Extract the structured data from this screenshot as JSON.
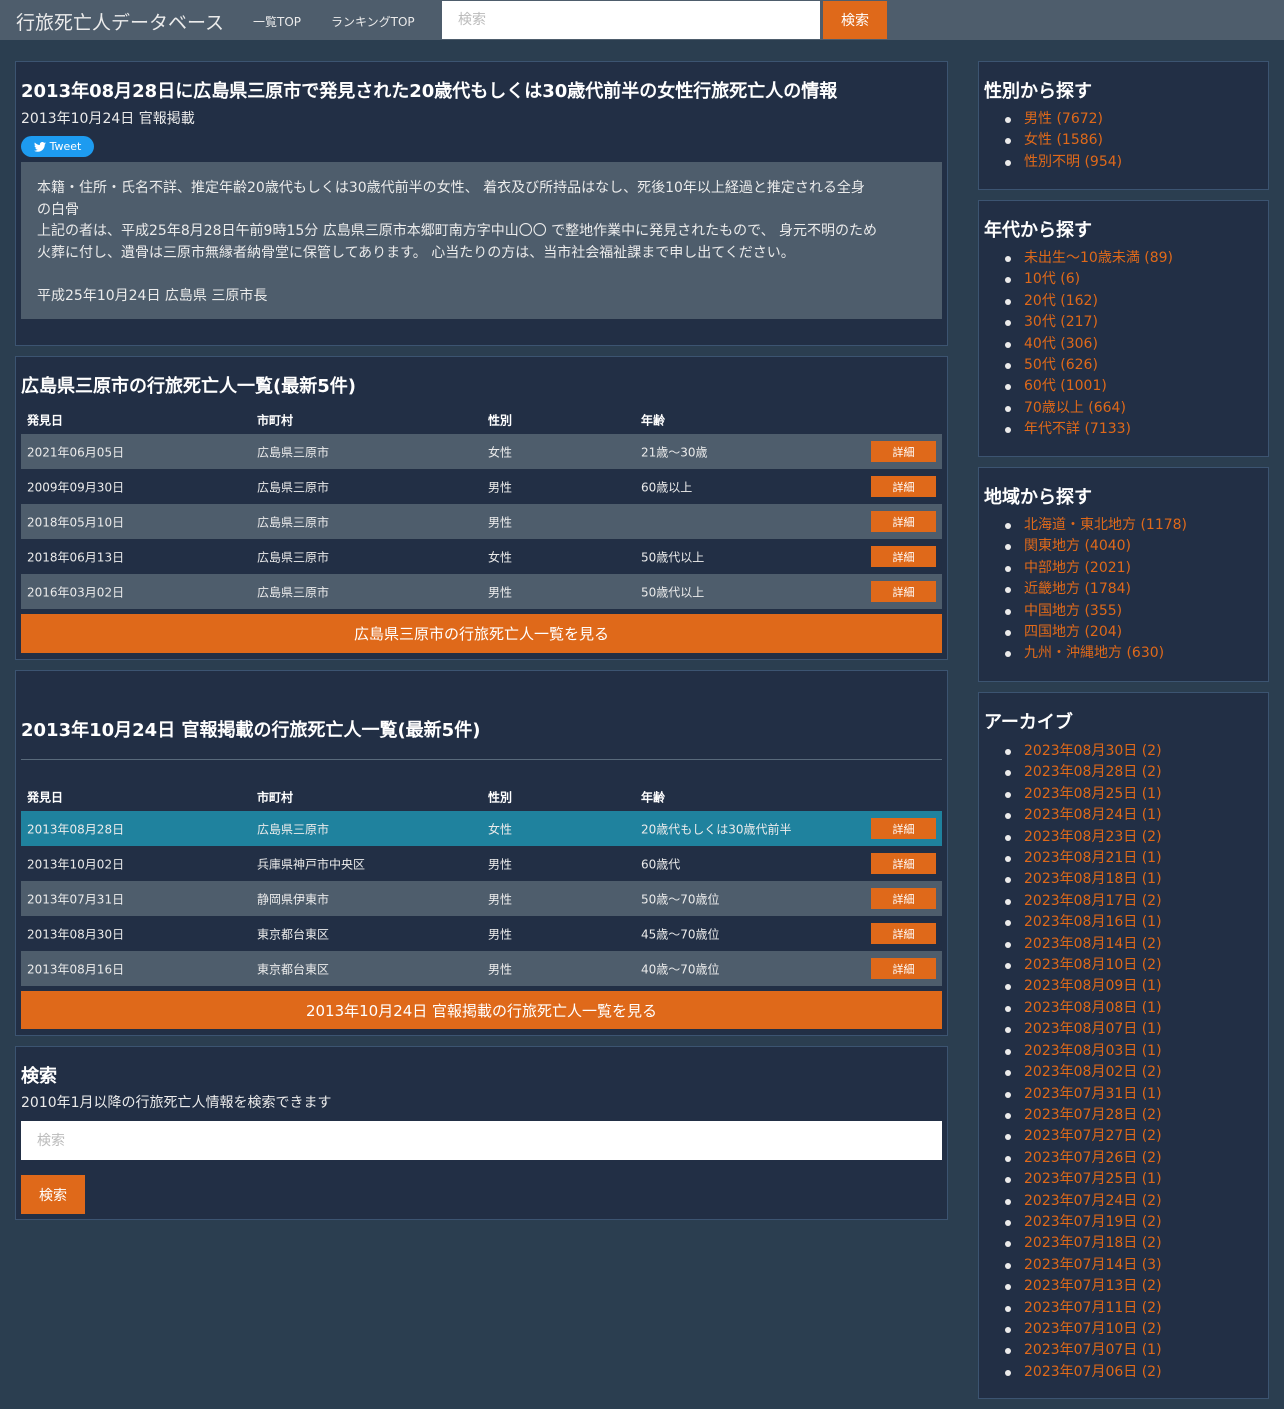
{
  "nav": {
    "brand": "行旅死亡人データベース",
    "links": [
      "一覧TOP",
      "ランキングTOP"
    ],
    "search_placeholder": "検索",
    "search_button": "検索"
  },
  "colors": {
    "background": "#2b3e50",
    "navbar": "#4e5d6c",
    "panel": "#222f45",
    "accent": "#df691a",
    "highlight_row": "#1f829e"
  },
  "detail": {
    "title": "2013年08月28日に広島県三原市で発見された20歳代もしくは30歳代前半の女性行旅死亡人の情報",
    "published": "2013年10月24日 官報掲載",
    "tweet_label": "Tweet",
    "body_lines": [
      "本籍・住所・氏名不詳、推定年齢20歳代もしくは30歳代前半の女性、 着衣及び所持品はなし、死後10年以上経過と推定される全身",
      "の白骨",
      "上記の者は、平成25年8月28日午前9時15分 広島県三原市本郷町南方字中山〇〇 で整地作業中に発見されたもので、 身元不明のため",
      "火葬に付し、遺骨は三原市無縁者納骨堂に保管してあります。 心当たりの方は、当市社会福祉課まで申し出てください。",
      "",
      "平成25年10月24日 広島県 三原市長"
    ]
  },
  "columns": [
    "発見日",
    "市町村",
    "性別",
    "年齢"
  ],
  "detail_button": "詳細",
  "city_list": {
    "title": "広島県三原市の行旅死亡人一覧(最新5件)",
    "rows": [
      [
        "2021年06月05日",
        "広島県三原市",
        "女性",
        "21歳～30歳"
      ],
      [
        "2009年09月30日",
        "広島県三原市",
        "男性",
        "60歳以上"
      ],
      [
        "2018年05月10日",
        "広島県三原市",
        "男性",
        ""
      ],
      [
        "2018年06月13日",
        "広島県三原市",
        "女性",
        "50歳代以上"
      ],
      [
        "2016年03月02日",
        "広島県三原市",
        "男性",
        "50歳代以上"
      ]
    ],
    "more_button": "広島県三原市の行旅死亡人一覧を見る"
  },
  "date_list": {
    "title": "2013年10月24日 官報掲載の行旅死亡人一覧(最新5件)",
    "rows": [
      [
        "2013年08月28日",
        "広島県三原市",
        "女性",
        "20歳代もしくは30歳代前半"
      ],
      [
        "2013年10月02日",
        "兵庫県神戸市中央区",
        "男性",
        "60歳代"
      ],
      [
        "2013年07月31日",
        "静岡県伊東市",
        "男性",
        "50歳～70歳位"
      ],
      [
        "2013年08月30日",
        "東京都台東区",
        "男性",
        "45歳～70歳位"
      ],
      [
        "2013年08月16日",
        "東京都台東区",
        "男性",
        "40歳～70歳位"
      ]
    ],
    "more_button": "2013年10月24日 官報掲載の行旅死亡人一覧を見る"
  },
  "search": {
    "title": "検索",
    "description": "2010年1月以降の行旅死亡人情報を検索できます",
    "placeholder": "検索",
    "button": "検索"
  },
  "sidebar": {
    "gender": {
      "title": "性別から探す",
      "items": [
        "男性 (7672)",
        "女性 (1586)",
        "性別不明 (954)"
      ]
    },
    "age": {
      "title": "年代から探す",
      "items": [
        "未出生～10歳未満 (89)",
        "10代 (6)",
        "20代 (162)",
        "30代 (217)",
        "40代 (306)",
        "50代 (626)",
        "60代 (1001)",
        "70歳以上 (664)",
        "年代不詳 (7133)"
      ]
    },
    "region": {
      "title": "地域から探す",
      "items": [
        "北海道・東北地方 (1178)",
        "関東地方 (4040)",
        "中部地方 (2021)",
        "近畿地方 (1784)",
        "中国地方 (355)",
        "四国地方 (204)",
        "九州・沖縄地方 (630)"
      ]
    },
    "archive": {
      "title": "アーカイブ",
      "items": [
        "2023年08月30日 (2)",
        "2023年08月28日 (2)",
        "2023年08月25日 (1)",
        "2023年08月24日 (1)",
        "2023年08月23日 (2)",
        "2023年08月21日 (1)",
        "2023年08月18日 (1)",
        "2023年08月17日 (2)",
        "2023年08月16日 (1)",
        "2023年08月14日 (2)",
        "2023年08月10日 (2)",
        "2023年08月09日 (1)",
        "2023年08月08日 (1)",
        "2023年08月07日 (1)",
        "2023年08月03日 (1)",
        "2023年08月02日 (2)",
        "2023年07月31日 (1)",
        "2023年07月28日 (2)",
        "2023年07月27日 (2)",
        "2023年07月26日 (2)",
        "2023年07月25日 (1)",
        "2023年07月24日 (2)",
        "2023年07月19日 (2)",
        "2023年07月18日 (2)",
        "2023年07月14日 (3)",
        "2023年07月13日 (2)",
        "2023年07月11日 (2)",
        "2023年07月10日 (2)",
        "2023年07月07日 (1)",
        "2023年07月06日 (2)"
      ]
    }
  }
}
